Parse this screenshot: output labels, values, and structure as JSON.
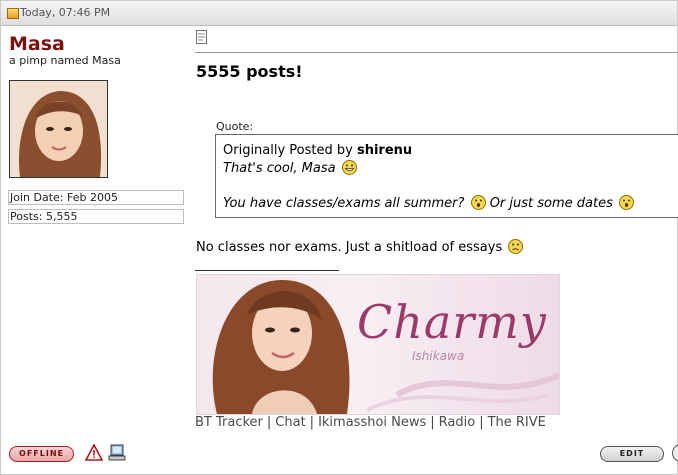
{
  "post_header": {
    "date": "Today, 07:46 PM"
  },
  "user": {
    "name": "Masa",
    "title": "a pimp named Masa",
    "join_date": "Join Date: Feb 2005",
    "posts": "Posts: 5,555"
  },
  "post": {
    "title": "5555 posts!",
    "quote_label": "Quote:",
    "quote_prefix": "Originally Posted by",
    "quote_author": "shirenu",
    "quote_line1": "That's cool, Masa",
    "quote_line2a": "You have classes/exams all summer?",
    "quote_line2b": "Or just some dates",
    "reply": "No classes nor exams. Just a shitload of essays"
  },
  "signature": {
    "banner_title": "Charmy",
    "banner_subtitle": "Ishikawa",
    "links": [
      "BT Tracker",
      "Chat",
      "Ikimasshoi News",
      "Radio",
      "The RIVE"
    ],
    "separator": "|"
  },
  "buttons": {
    "offline": "OFFLINE",
    "edit": "EDIT"
  },
  "colors": {
    "username": "#7a1010",
    "banner_text": "#9a3a6a",
    "offline": "#a52020"
  }
}
